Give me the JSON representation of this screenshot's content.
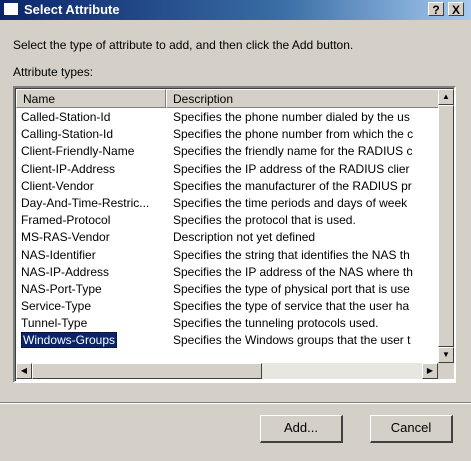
{
  "window": {
    "title": "Select Attribute",
    "help_label": "?",
    "close_label": "X"
  },
  "instruction": "Select the type of attribute to add, and then click the Add button.",
  "list_label": "Attribute types:",
  "columns": {
    "name": "Name",
    "description": "Description"
  },
  "rows": [
    {
      "name": "Called-Station-Id",
      "description": "Specifies the phone number dialed by the us"
    },
    {
      "name": "Calling-Station-Id",
      "description": "Specifies the phone number from which the c"
    },
    {
      "name": "Client-Friendly-Name",
      "description": "Specifies the friendly name for the RADIUS c"
    },
    {
      "name": "Client-IP-Address",
      "description": "Specifies the IP address of the RADIUS clier"
    },
    {
      "name": "Client-Vendor",
      "description": "Specifies the manufacturer of the RADIUS pr"
    },
    {
      "name": "Day-And-Time-Restric...",
      "description": "Specifies the time periods and days of week"
    },
    {
      "name": "Framed-Protocol",
      "description": "Specifies the protocol that is used."
    },
    {
      "name": "MS-RAS-Vendor",
      "description": "Description not yet defined"
    },
    {
      "name": "NAS-Identifier",
      "description": "Specifies the string that identifies the NAS th"
    },
    {
      "name": "NAS-IP-Address",
      "description": "Specifies the IP address of the NAS where th"
    },
    {
      "name": "NAS-Port-Type",
      "description": "Specifies the type of physical port that is use"
    },
    {
      "name": "Service-Type",
      "description": "Specifies the type of service that the user ha"
    },
    {
      "name": "Tunnel-Type",
      "description": "Specifies the tunneling protocols used."
    },
    {
      "name": "Windows-Groups",
      "description": "Specifies the Windows groups that the user t"
    }
  ],
  "selected_row": "Windows-Groups",
  "buttons": {
    "add": "Add...",
    "cancel": "Cancel"
  },
  "colors": {
    "title_bar": "#0a246a",
    "selection": "#0a246a",
    "face": "#d4d0c8"
  }
}
